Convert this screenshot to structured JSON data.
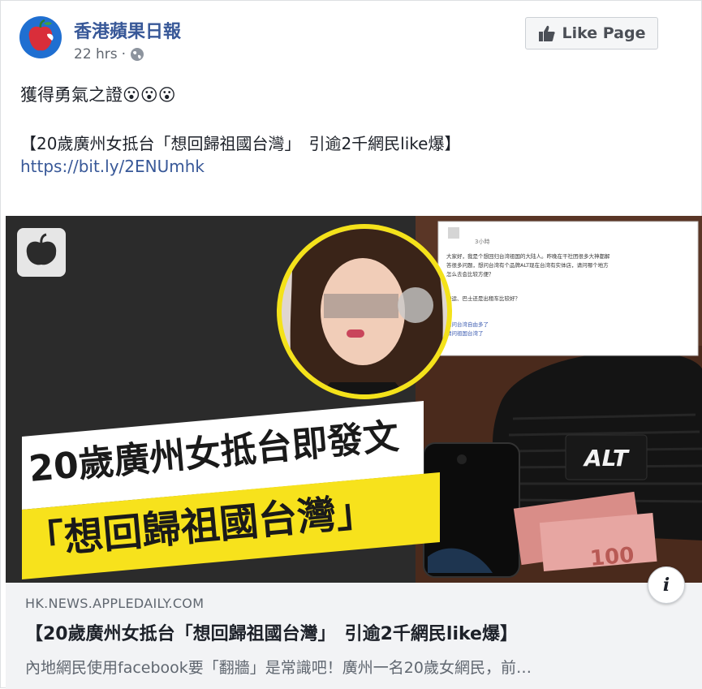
{
  "post": {
    "page_name": "香港蘋果日報",
    "time": "22 hrs",
    "separator": "·",
    "like_label": "Like Page",
    "text": "獲得勇氣之證😮😮😮",
    "headline": "【20歲廣州女抵台「想回歸祖國台灣」　引逾2千網民like爆】",
    "url": "https://bit.ly/2ENUmhk"
  },
  "image": {
    "title_line1": "20歲廣州女抵台即發文",
    "title_line2": "「想回歸祖國台灣」",
    "hat_text": "ALT",
    "screenshot_lines": [
      "大家好，我是个想回归台湾祖国的大陆人。昨晚在干社团很多大神都解",
      "答很多问题，想问台湾有个品牌ALT现在台湾有实体店，请问哪个地方",
      "怎么去会比较方便？",
      "捷运、巴士还是出租车比较好？",
      "请问台湾自由多了",
      "请问祖国台湾了"
    ],
    "screenshot_time": "3小時"
  },
  "link": {
    "domain": "HK.NEWS.APPLEDAILY.COM",
    "title": "【20歲廣州女抵台「想回歸祖國台灣」　引逾2千網民like爆】",
    "description": "內地網民使用facebook要「翻牆」是常識吧！廣州一名20歲女網民，前…",
    "info_label": "i"
  },
  "colors": {
    "accent_link": "#385898",
    "banner_yellow": "#f7e21c"
  }
}
